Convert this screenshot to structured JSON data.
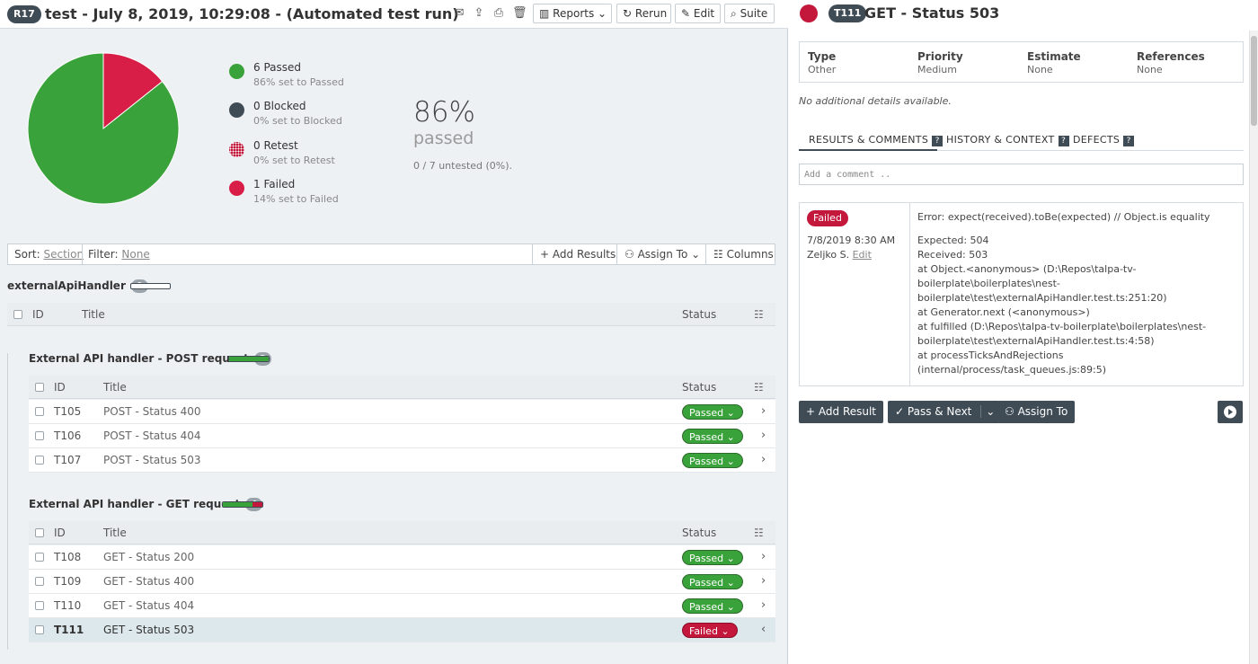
{
  "header": {
    "run_badge": "R17",
    "title": "test - July 8, 2019, 10:29:08 - (Automated test run)",
    "buttons": {
      "reports": "Reports",
      "rerun": "Rerun",
      "edit": "Edit",
      "suite": "Suite"
    }
  },
  "stats": {
    "legend": [
      {
        "title": "6 Passed",
        "sub": "86% set to Passed",
        "color": "#3aa23a"
      },
      {
        "title": "0 Blocked",
        "sub": "0% set to Blocked",
        "color": "#3f4b55"
      },
      {
        "title": "0 Retest",
        "sub": "0% set to Retest",
        "color": "#c3173c"
      },
      {
        "title": "1 Failed",
        "sub": "14% set to Failed",
        "color": "#d81e46"
      }
    ],
    "percent": "86%",
    "percent_label": "passed",
    "untested": "0 / 7 untested (0%).",
    "pie": {
      "passed": 6,
      "failed": 1
    }
  },
  "filterbar": {
    "sort_label": "Sort:",
    "sort_value": "Section",
    "filter_label": "Filter:",
    "filter_value": "None",
    "add_results": "Add Results",
    "assign_to": "Assign To",
    "columns": "Columns"
  },
  "root_section": {
    "title": "externalApiHandler",
    "count": "0"
  },
  "columns": {
    "id": "ID",
    "title": "Title",
    "status": "Status"
  },
  "sections": [
    {
      "title": "External API handler - POST request",
      "count": "3",
      "rows": [
        {
          "id": "T105",
          "title": "POST - Status 400",
          "status": "Passed"
        },
        {
          "id": "T106",
          "title": "POST - Status 404",
          "status": "Passed"
        },
        {
          "id": "T107",
          "title": "POST - Status 503",
          "status": "Passed"
        }
      ]
    },
    {
      "title": "External API handler - GET request",
      "count": "4",
      "rows": [
        {
          "id": "T108",
          "title": "GET - Status 200",
          "status": "Passed"
        },
        {
          "id": "T109",
          "title": "GET - Status 400",
          "status": "Passed"
        },
        {
          "id": "T110",
          "title": "GET - Status 404",
          "status": "Passed"
        },
        {
          "id": "T111",
          "title": "GET - Status 503",
          "status": "Failed"
        }
      ]
    }
  ],
  "detail": {
    "badge": "T111",
    "title": "GET - Status 503",
    "meta": [
      {
        "label": "Type",
        "value": "Other"
      },
      {
        "label": "Priority",
        "value": "Medium"
      },
      {
        "label": "Estimate",
        "value": "None"
      },
      {
        "label": "References",
        "value": "None"
      }
    ],
    "no_details": "No additional details available.",
    "tabs": [
      "RESULTS & COMMENTS",
      "HISTORY & CONTEXT",
      "DEFECTS"
    ],
    "comment_placeholder": "Add a comment ..",
    "result": {
      "status": "Failed",
      "date": "7/8/2019 8:30 AM",
      "user": "Zeljko S.",
      "edit": "Edit",
      "lines": [
        "Error: expect(received).toBe(expected) // Object.is equality",
        "",
        "Expected: 504",
        "Received: 503",
        "at Object.<anonymous> (D:\\Repos\\talpa-tv-",
        "boilerplate\\boilerplates\\nest-",
        "boilerplate\\test\\externalApiHandler.test.ts:251:20)",
        "at Generator.next (<anonymous>)",
        "at fulfilled (D:\\Repos\\talpa-tv-boilerplate\\boilerplates\\nest-",
        "boilerplate\\test\\externalApiHandler.test.ts:4:58)",
        "at processTicksAndRejections",
        "(internal/process/task_queues.js:89:5)"
      ]
    },
    "actions": {
      "add_result": "Add Result",
      "pass_next": "Pass & Next",
      "assign_to": "Assign To"
    }
  }
}
